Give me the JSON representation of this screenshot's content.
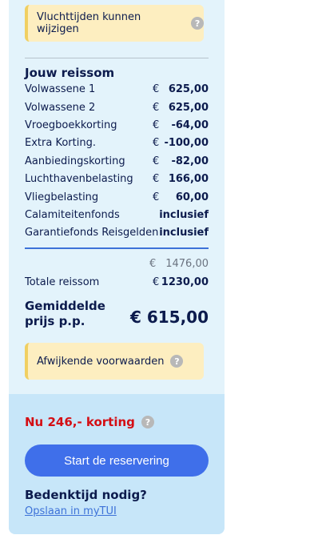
{
  "notices": {
    "flight_times": "Vluchttijden kunnen wijzigen",
    "conditions": "Afwijkende voorwaarden"
  },
  "summary": {
    "title": "Jouw reissom",
    "currency": "€",
    "rows": [
      {
        "label": "Volwassene 1",
        "amount": "625,00"
      },
      {
        "label": "Volwassene 2",
        "amount": "625,00"
      },
      {
        "label": "Vroegboekkorting",
        "amount": "-64,00"
      },
      {
        "label": "Extra Korting.",
        "amount": "-100,00"
      },
      {
        "label": "Aanbiedingskorting",
        "amount": "-82,00"
      },
      {
        "label": "Luchthavenbelasting",
        "amount": "166,00"
      },
      {
        "label": "Vliegbelasting",
        "amount": "60,00"
      },
      {
        "label": "Calamiteitenfonds",
        "amount": "inclusief"
      },
      {
        "label": "Garantiefonds Reisgelden",
        "amount": "inclusief"
      }
    ],
    "old_total": "1476,00",
    "total_label": "Totale reissom",
    "total_amount": "1230,00",
    "avg_label_line1": "Gemiddelde",
    "avg_label_line2": "prijs p.p.",
    "avg_value": "€ 615,00"
  },
  "cta": {
    "discount_text": "Nu 246,- korting",
    "button_label": "Start de reservering",
    "think_title": "Bedenktijd nodig?",
    "save_link": "Opslaan in myTUI"
  },
  "colors": {
    "panel": "#e3f3fb",
    "bottom": "#c7e6f9",
    "notice": "#fdeec0",
    "accent_button": "#3f6fea",
    "discount_red": "#d40e14"
  },
  "icons": {
    "help": "question-circle-icon"
  }
}
